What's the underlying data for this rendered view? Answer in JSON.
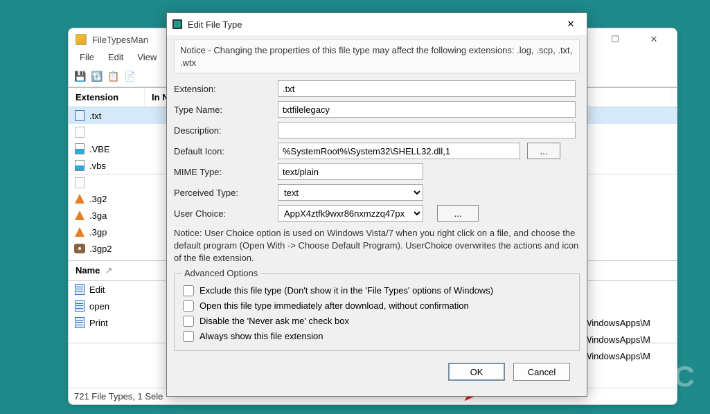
{
  "main": {
    "title": "FileTypesMan",
    "menu": {
      "file": "File",
      "edit": "Edit",
      "view": "View"
    },
    "columns": {
      "extension": "Extension",
      "in_new_menu": "In New Menu"
    },
    "ext_rows": [
      {
        "label": ".txt",
        "icon": "doc-blue",
        "selected": true
      },
      {
        "label": "",
        "icon": "doc-grey"
      },
      {
        "label": ".VBE",
        "icon": "script"
      },
      {
        "label": ".vbs",
        "icon": "script"
      },
      {
        "label": "",
        "icon": "doc-grey",
        "separator": true
      },
      {
        "label": ".3g2",
        "icon": "vlc"
      },
      {
        "label": ".3ga",
        "icon": "vlc"
      },
      {
        "label": ".3gp",
        "icon": "vlc"
      },
      {
        "label": ".3gp2",
        "icon": "gimp"
      }
    ],
    "name_col": "Name",
    "actions": [
      {
        "label": "Edit"
      },
      {
        "label": "open"
      },
      {
        "label": "Print"
      }
    ],
    "right_values": [
      "WindowsApps\\M",
      "WindowsApps\\M",
      "WindowsApps\\M"
    ],
    "status": "721 File Types, 1 Sele"
  },
  "dialog": {
    "title": "Edit File Type",
    "notice": "Notice - Changing the properties of this file type may affect the following extensions: .log, .scp, .txt, .wtx",
    "labels": {
      "extension": "Extension:",
      "type_name": "Type Name:",
      "description": "Description:",
      "default_icon": "Default Icon:",
      "mime": "MIME Type:",
      "perceived": "Perceived Type:",
      "user_choice": "User Choice:"
    },
    "values": {
      "extension": ".txt",
      "type_name": "txtfilelegacy",
      "description": "",
      "default_icon": "%SystemRoot%\\System32\\SHELL32.dll,1",
      "mime": "text/plain",
      "perceived": "text",
      "user_choice": "AppX4ztfk9wxr86nxmzzq47px"
    },
    "browse": "...",
    "sub_notice": "Notice: User Choice option is used on Windows Vista/7 when you right click on a file, and choose the default program (Open With -> Choose Default Program). UserChoice overwrites the actions and icon of the file extension.",
    "group_legend": "Advanced Options",
    "checks": {
      "exclude": "Exclude  this file type (Don't show it in the 'File Types' options of Windows)",
      "open_immediate": "Open this file type immediately after download, without confirmation",
      "disable_never": "Disable the 'Never ask me' check box",
      "always_show": "Always show this file extension"
    },
    "buttons": {
      "ok": "OK",
      "cancel": "Cancel"
    }
  },
  "watermark": "DC"
}
